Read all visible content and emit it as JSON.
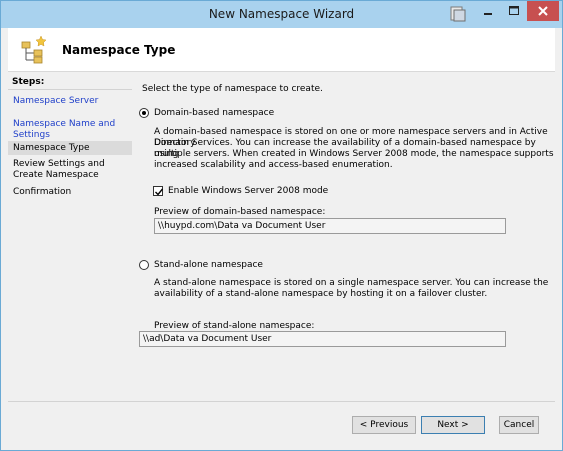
{
  "window": {
    "title": "New Namespace Wizard"
  },
  "header": {
    "title": "Namespace Type",
    "icon": "wizard-folder-tree-icon"
  },
  "steps": {
    "label": "Steps:",
    "items": [
      {
        "label": "Namespace Server",
        "state": "link"
      },
      {
        "label": "Namespace Name and Settings",
        "state": "link"
      },
      {
        "label": "Namespace Type",
        "state": "current"
      },
      {
        "label": "Review Settings and Create Namespace",
        "state": "plain"
      },
      {
        "label": "Confirmation",
        "state": "plain"
      }
    ]
  },
  "content": {
    "instruction": "Select the type of namespace to create.",
    "domain_based": {
      "label": "Domain-based namespace",
      "selected": true,
      "description": [
        "A domain-based namespace is stored on one or more namespace servers and in Active Directory",
        "Domain Services. You can increase the availability of a domain-based namespace by using",
        "multiple servers. When created in Windows Server 2008 mode, the namespace supports",
        "increased scalability and access-based enumeration."
      ],
      "ws2008_mode_label": "Enable Windows Server 2008 mode",
      "ws2008_mode_checked": true,
      "preview_label": "Preview of domain-based namespace:",
      "preview_value": "\\\\huypd.com\\Data va Document User"
    },
    "standalone": {
      "label": "Stand-alone namespace",
      "selected": false,
      "description": [
        "A stand-alone namespace is stored on a single namespace server. You can increase the",
        "availability of a stand-alone namespace by hosting it on a failover cluster."
      ],
      "preview_label": "Preview of stand-alone namespace:",
      "preview_value": "\\\\ad\\Data va Document User"
    }
  },
  "buttons": {
    "previous": "< Previous",
    "next": "Next >",
    "cancel": "Cancel"
  },
  "colors": {
    "titlebar": "#a9d2ee",
    "close_button": "#c75050",
    "step_link": "#1f3fc9"
  }
}
